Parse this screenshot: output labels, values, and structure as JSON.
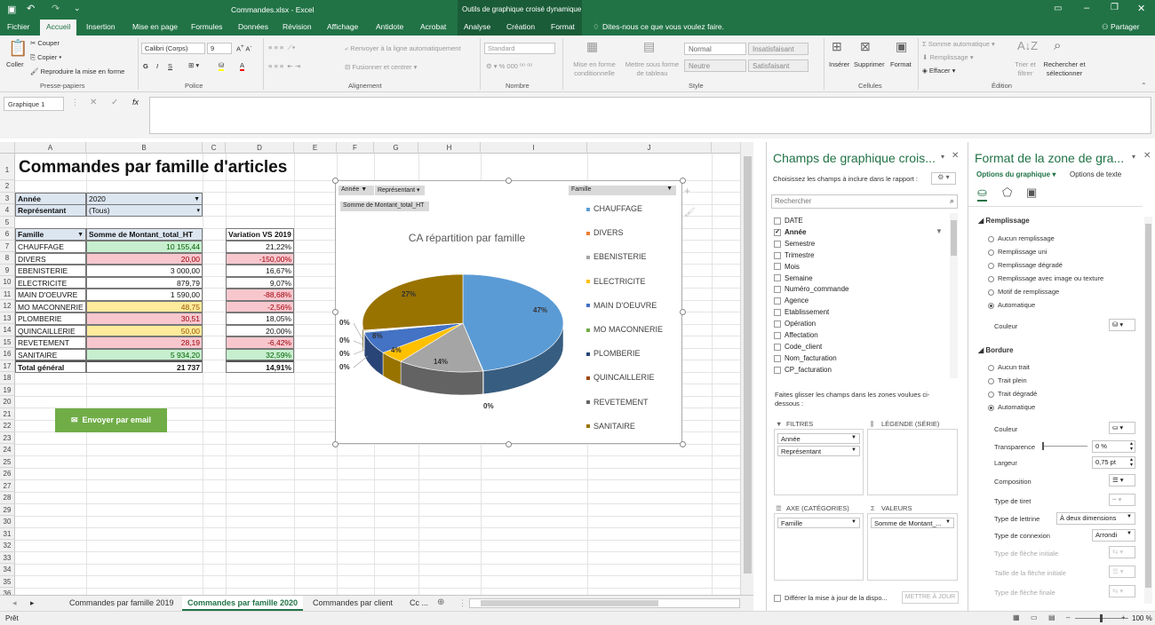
{
  "window": {
    "title": "Commandes.xlsx - Excel",
    "contextual": "Outils de graphique croisé dynamique",
    "partager": "Partager"
  },
  "tabs": [
    "Fichier",
    "Accueil",
    "Insertion",
    "Mise en page",
    "Formules",
    "Données",
    "Révision",
    "Affichage",
    "Antidote",
    "Acrobat",
    "Analyse",
    "Création",
    "Format"
  ],
  "tellme": "Dites-nous ce que vous voulez faire.",
  "ribbon": {
    "coller": "Coller",
    "couper": "Couper",
    "copier": "Copier",
    "reproduire": "Reproduire la mise en forme",
    "presse": "Presse-papiers",
    "font_name": "Calibri (Corps)",
    "font_size": "9",
    "police": "Police",
    "renvoyer": "Renvoyer à la ligne automatiquement",
    "fusionner": "Fusionner et centrer",
    "alignement": "Alignement",
    "number_format": "Standard",
    "pct": "% 000",
    "nombre": "Nombre",
    "mise_forme_cond": "Mise en forme conditionnelle",
    "mettre_tableau": "Mettre sous forme de tableau",
    "normal": "Normal",
    "insatisfaisant": "Insatisfaisant",
    "neutre": "Neutre",
    "satisfaisant": "Satisfaisant",
    "style": "Style",
    "inserer": "Insérer",
    "supprimer": "Supprimer",
    "format": "Format",
    "cellules": "Cellules",
    "somme": "Somme automatique",
    "remplissage": "Remplissage",
    "effacer": "Effacer",
    "trier": "Trier et filtrer",
    "rechercher": "Rechercher et sélectionner",
    "edition": "Édition"
  },
  "namebox": "Graphique 1",
  "columns": [
    "A",
    "B",
    "C",
    "D",
    "E",
    "F",
    "G",
    "H",
    "I",
    "J"
  ],
  "rows": [
    "1",
    "2",
    "3",
    "4",
    "5",
    "6",
    "7",
    "8",
    "9",
    "10",
    "11",
    "12",
    "13",
    "14",
    "15",
    "16",
    "17",
    "18",
    "19",
    "20",
    "21",
    "22",
    "23",
    "24",
    "25",
    "26",
    "27",
    "28",
    "29",
    "30",
    "31",
    "32",
    "33",
    "34",
    "35",
    "36"
  ],
  "sheet": {
    "title": "Commandes par famille d'articles",
    "annee_label": "Année",
    "annee_value": "2020",
    "rep_label": "Représentant",
    "rep_value": "(Tous)",
    "hdr_famille": "Famille",
    "hdr_somme": "Somme de Montant_total_HT",
    "hdr_variation": "Variation VS 2019",
    "table": [
      {
        "famille": "CHAUFFAGE",
        "montant": "10 155,44",
        "variation": "21,22%",
        "mc": "grn",
        "vc": ""
      },
      {
        "famille": "DIVERS",
        "montant": "20,00",
        "variation": "-150,00%",
        "mc": "red",
        "vc": "red"
      },
      {
        "famille": "EBENISTERIE",
        "montant": "3 000,00",
        "variation": "16,67%",
        "mc": "",
        "vc": ""
      },
      {
        "famille": "ELECTRICITE",
        "montant": "879,79",
        "variation": "9,07%",
        "mc": "",
        "vc": ""
      },
      {
        "famille": "MAIN D'OEUVRE",
        "montant": "1 590,00",
        "variation": "-88,68%",
        "mc": "",
        "vc": "red"
      },
      {
        "famille": "MO MACONNERIE",
        "montant": "48,75",
        "variation": "-2,56%",
        "mc": "yel",
        "vc": "red"
      },
      {
        "famille": "PLOMBERIE",
        "montant": "30,51",
        "variation": "18,05%",
        "mc": "red",
        "vc": ""
      },
      {
        "famille": "QUINCAILLERIE",
        "montant": "50,00",
        "variation": "20,00%",
        "mc": "yel",
        "vc": ""
      },
      {
        "famille": "REVETEMENT",
        "montant": "28,19",
        "variation": "-6,42%",
        "mc": "red",
        "vc": "red"
      },
      {
        "famille": "SANITAIRE",
        "montant": "5 934,20",
        "variation": "32,59%",
        "mc": "grn",
        "vc": "grn"
      }
    ],
    "total_label": "Total général",
    "total_value": "21 737",
    "total_var": "14,91%",
    "email_button": "Envoyer par email"
  },
  "chart_data": {
    "type": "pie",
    "title": "CA répartition par famille",
    "filter_annee": "Année",
    "filter_rep": "Représentant",
    "filter_famille": "Famille",
    "value_field": "Somme de Montant_total_HT",
    "categories": [
      "CHAUFFAGE",
      "DIVERS",
      "EBENISTERIE",
      "ELECTRICITE",
      "MAIN D'OEUVRE",
      "MO MACONNERIE",
      "PLOMBERIE",
      "QUINCAILLERIE",
      "REVETEMENT",
      "SANITAIRE"
    ],
    "values": [
      10155.44,
      20.0,
      3000.0,
      879.79,
      1590.0,
      48.75,
      30.51,
      50.0,
      28.19,
      5934.2
    ],
    "data_labels": [
      "47%",
      "0%",
      "14%",
      "4%",
      "8%",
      "0%",
      "0%",
      "0%",
      "0%",
      "27%"
    ],
    "colors": [
      "#5b9bd5",
      "#ed7d31",
      "#a5a5a5",
      "#ffc000",
      "#4472c4",
      "#70ad47",
      "#264478",
      "#9e480e",
      "#636363",
      "#997300"
    ]
  },
  "sheet_tabs": [
    "Commandes par famille 2019",
    "Commandes par famille 2020",
    "Commandes par client",
    "Cc ..."
  ],
  "status": {
    "ready": "Prêt",
    "zoom": "100 %"
  },
  "field_pane": {
    "title": "Champs de graphique crois...",
    "instructions": "Choisissez les champs à inclure dans le rapport :",
    "search_placeholder": "Rechercher",
    "fields": [
      {
        "name": "DATE",
        "checked": false
      },
      {
        "name": "Année",
        "checked": true
      },
      {
        "name": "Semestre",
        "checked": false
      },
      {
        "name": "Trimestre",
        "checked": false
      },
      {
        "name": "Mois",
        "checked": false
      },
      {
        "name": "Semaine",
        "checked": false
      },
      {
        "name": "Numéro_commande",
        "checked": false
      },
      {
        "name": "Agence",
        "checked": false
      },
      {
        "name": "Etablissement",
        "checked": false
      },
      {
        "name": "Opération",
        "checked": false
      },
      {
        "name": "Affectation",
        "checked": false
      },
      {
        "name": "Code_client",
        "checked": false
      },
      {
        "name": "Nom_facturation",
        "checked": false
      },
      {
        "name": "CP_facturation",
        "checked": false
      }
    ],
    "drag_text": "Faites glisser les champs dans les zones voulues ci-dessous :",
    "zone_filtres": "FILTRES",
    "zone_legende": "LÉGENDE (SÉRIE)",
    "zone_axe": "AXE (CATÉGORIES)",
    "zone_valeurs": "VALEURS",
    "filtres_items": [
      "Année",
      "Représentant"
    ],
    "axe_items": [
      "Famille"
    ],
    "valeurs_items": [
      "Somme de Montant_..."
    ],
    "defer": "Différer la mise à jour de la dispo...",
    "update": "METTRE À JOUR"
  },
  "format_pane": {
    "title": "Format de la zone de gra...",
    "options_graphique": "Options du graphique",
    "options_texte": "Options de texte",
    "remplissage": "Remplissage",
    "fill_options": [
      {
        "label": "Aucun remplissage",
        "on": false
      },
      {
        "label": "Remplissage uni",
        "on": false
      },
      {
        "label": "Remplissage dégradé",
        "on": false
      },
      {
        "label": "Remplissage avec image ou texture",
        "on": false
      },
      {
        "label": "Motif de remplissage",
        "on": false
      },
      {
        "label": "Automatique",
        "on": true
      }
    ],
    "couleur": "Couleur",
    "bordure": "Bordure",
    "border_options": [
      {
        "label": "Aucun trait",
        "on": false
      },
      {
        "label": "Trait plein",
        "on": false
      },
      {
        "label": "Trait dégradé",
        "on": false
      },
      {
        "label": "Automatique",
        "on": true
      }
    ],
    "couleur2": "Couleur",
    "transparence": "Transparence",
    "transparence_val": "0 %",
    "largeur": "Largeur",
    "largeur_val": "0,75 pt",
    "composition": "Composition",
    "type_tiret": "Type de tiret",
    "type_lettrine": "Type de lettrine",
    "lettrine_val": "À deux dimensions",
    "type_connexion": "Type de connexion",
    "connexion_val": "Arrondi",
    "fleche_initiale": "Type de flèche initiale",
    "taille_initiale": "Taille de la flèche initiale",
    "fleche_finale": "Type de flèche finale"
  }
}
